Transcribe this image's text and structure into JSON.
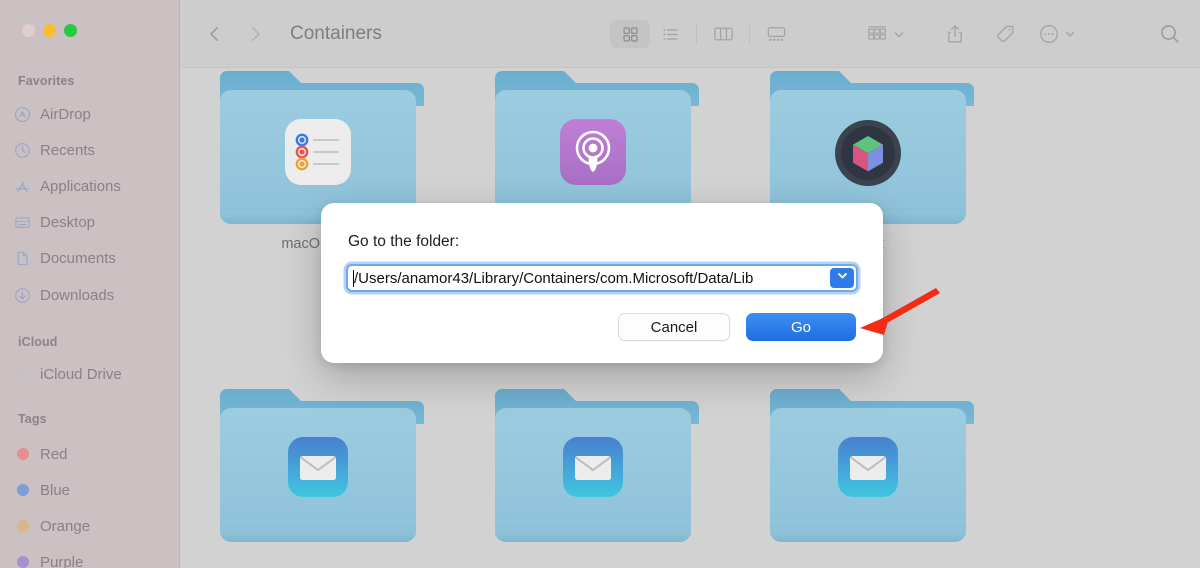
{
  "window": {
    "traffic_lights": [
      {
        "name": "close",
        "color": "#e0cdd1"
      },
      {
        "name": "minimize",
        "color": "#fdbc2e"
      },
      {
        "name": "maximize",
        "color": "#28c840"
      }
    ]
  },
  "sidebar": {
    "sections": [
      {
        "title": "Favorites",
        "items": [
          {
            "label": "AirDrop",
            "icon": "airdrop-icon"
          },
          {
            "label": "Recents",
            "icon": "clock-icon"
          },
          {
            "label": "Applications",
            "icon": "appstore-icon"
          },
          {
            "label": "Desktop",
            "icon": "desktop-icon"
          },
          {
            "label": "Documents",
            "icon": "document-icon"
          },
          {
            "label": "Downloads",
            "icon": "download-icon"
          }
        ]
      },
      {
        "title": "iCloud",
        "items": [
          {
            "label": "iCloud Drive",
            "icon": "cloud-icon"
          }
        ]
      },
      {
        "title": "Tags",
        "items": [
          {
            "label": "Red",
            "icon": "tag-dot-icon",
            "color": "#e58f8f"
          },
          {
            "label": "Blue",
            "icon": "tag-dot-icon",
            "color": "#7d9ed6"
          },
          {
            "label": "Orange",
            "icon": "tag-dot-icon",
            "color": "#d9b58a"
          },
          {
            "label": "Purple",
            "icon": "tag-dot-icon",
            "color": "#a88fcf"
          }
        ]
      }
    ]
  },
  "toolbar": {
    "back_icon": "chevron-left-icon",
    "forward_icon": "chevron-right-icon",
    "breadcrumb": "Containers",
    "views": [
      {
        "name": "icon-view",
        "icon": "grid-icon",
        "active": true
      },
      {
        "name": "list-view",
        "icon": "list-icon",
        "active": false
      },
      {
        "name": "column-view",
        "icon": "columns-icon",
        "active": false
      },
      {
        "name": "gallery-view",
        "icon": "gallery-icon",
        "active": false
      }
    ],
    "group_icon": "group-by-icon",
    "group_chevron_icon": "chevron-down-icon",
    "share_icon": "share-icon",
    "tag_icon": "tag-icon",
    "more_icon": "ellipsis-circle-icon",
    "more_chevron_icon": "chevron-down-icon",
    "search_icon": "search-icon"
  },
  "content": {
    "folders": [
      {
        "label": "macOSWid",
        "embed": "reminders-icon",
        "row": 0,
        "col": 0
      },
      {
        "label": "",
        "embed": "podcasts-icon",
        "row": 0,
        "col": 1
      },
      {
        "label": "idget",
        "embed": "cube-icon",
        "row": 0,
        "col": 2
      },
      {
        "label": "",
        "embed": "mail-icon",
        "row": 1,
        "col": 0
      },
      {
        "label": "",
        "embed": "mail-icon",
        "row": 1,
        "col": 1
      },
      {
        "label": "",
        "embed": "mail-icon",
        "row": 1,
        "col": 2
      }
    ]
  },
  "dialog": {
    "title": "Go to the folder:",
    "path_value": "/Users/anamor43/Library/Containers/com.Microsoft/Data/Lib",
    "path_placeholder": "",
    "dropdown_icon": "chevron-down-icon",
    "cancel_label": "Cancel",
    "go_label": "Go",
    "accent_color": "#2f7ce8",
    "focus_ring_color": "#6faaf0"
  },
  "annotation": {
    "arrow": {
      "name": "red-arrow-pointing-to-go-button",
      "color": "#f22c14"
    }
  }
}
